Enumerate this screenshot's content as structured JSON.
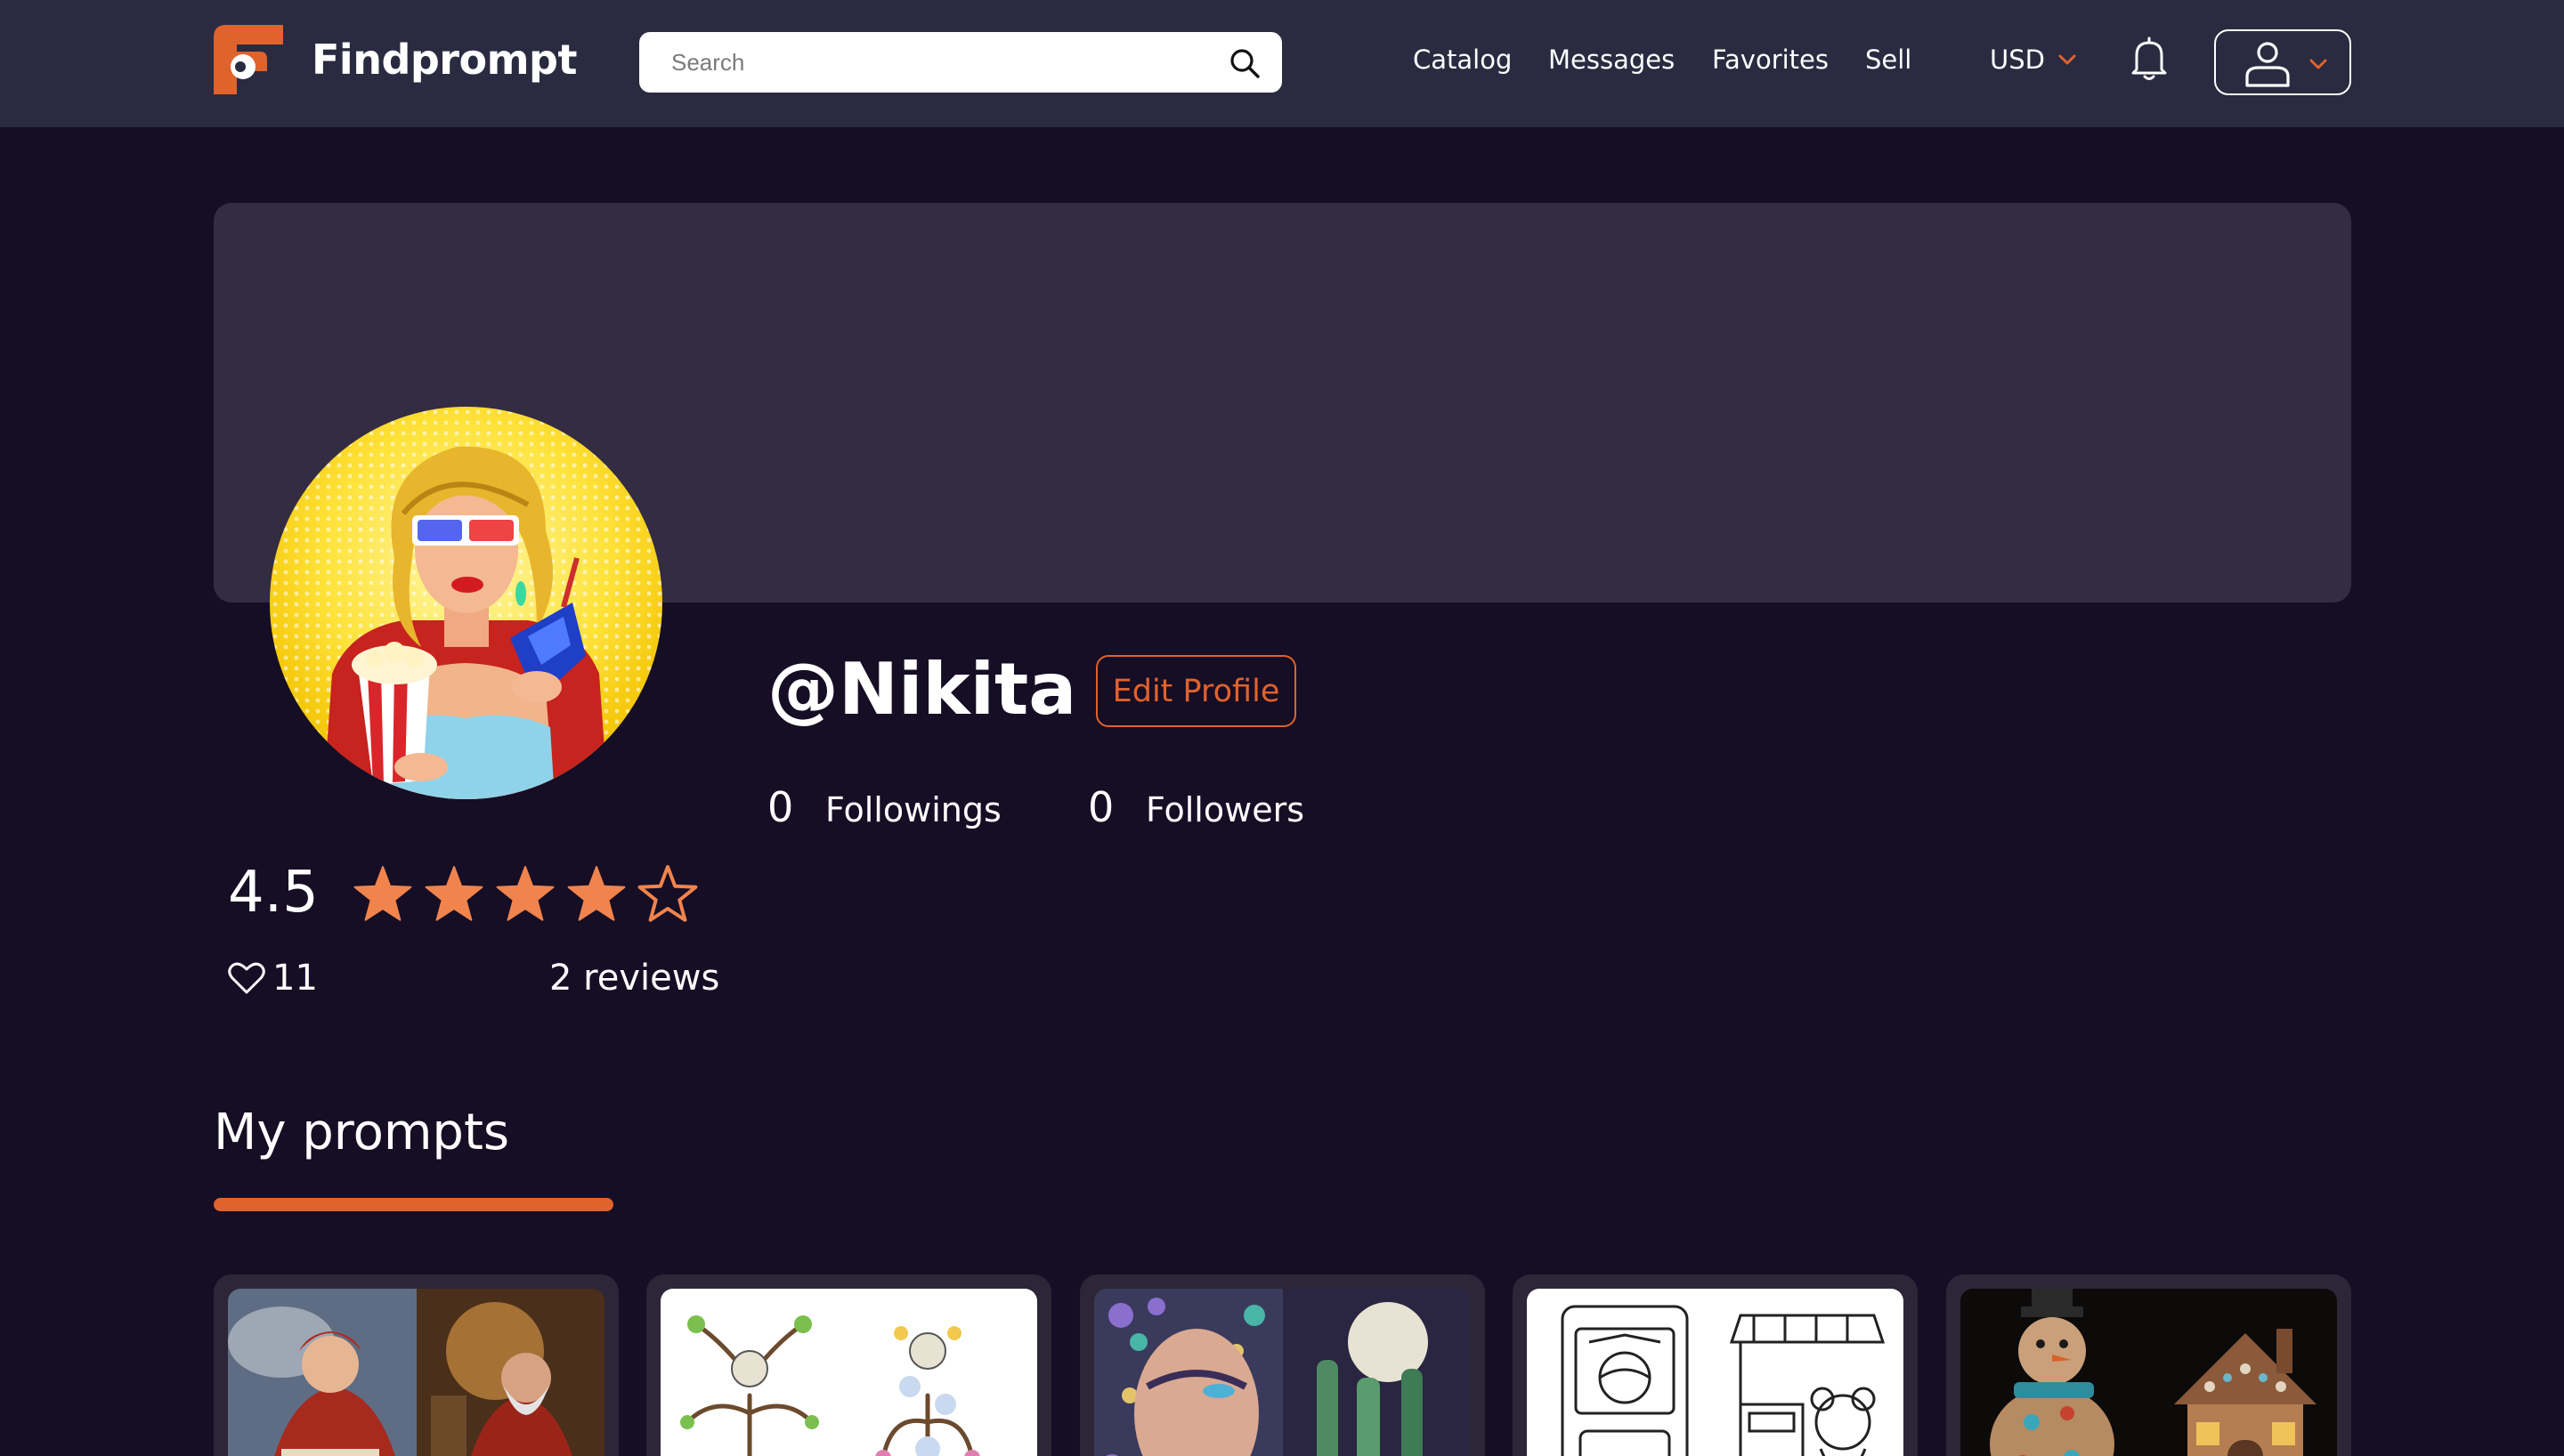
{
  "header": {
    "logo_text": "Findprompt",
    "search_placeholder": "Search",
    "nav": [
      "Catalog",
      "Messages",
      "Favorites",
      "Sell"
    ],
    "currency": "USD",
    "accent_color": "#e0622d"
  },
  "profile": {
    "username": "@Nikita",
    "edit_label": "Edit Profile",
    "followings_count": "0",
    "followings_label": "Followings",
    "followers_count": "0",
    "followers_label": "Followers",
    "rating": "4.5",
    "rating_value": 4.5,
    "rating_max": 5,
    "likes": "11",
    "reviews": "2 reviews"
  },
  "prompts": {
    "title": "My prompts",
    "cards": [
      {
        "theme": "renaissance-painting"
      },
      {
        "theme": "floral-skeletons"
      },
      {
        "theme": "gem-portrait-cactus"
      },
      {
        "theme": "coloring-page-vending"
      },
      {
        "theme": "ornate-snowman-house"
      }
    ]
  }
}
